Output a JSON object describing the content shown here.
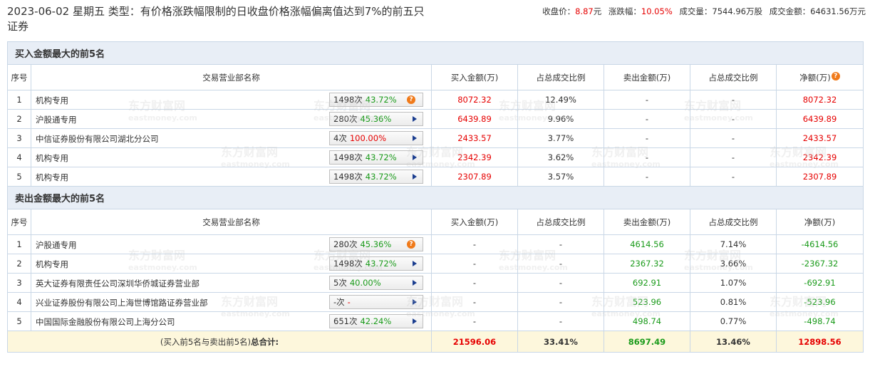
{
  "header": {
    "title": "2023-06-02 星期五 类型：有价格涨跌幅限制的日收盘价格涨幅偏离值达到7%的前五只证券",
    "close_label": "收盘价：",
    "close_value": "8.87",
    "close_unit": "元",
    "change_label": "涨跌幅：",
    "change_value": "10.05%",
    "volume_label": "成交量：",
    "volume_value": "7544.96万股",
    "amount_label": "成交金额：",
    "amount_value": "64631.56万元"
  },
  "buy_section": {
    "title": "买入金额最大的前5名",
    "columns": [
      "序号",
      "交易营业部名称",
      "买入金额(万)",
      "占总成交比例",
      "卖出金额(万)",
      "占总成交比例",
      "净额(万)"
    ],
    "rows": [
      {
        "idx": "1",
        "name": "机构专用",
        "times": "1498次",
        "pct": "43.72%",
        "icon": "question-icon",
        "buy": "8072.32",
        "buy_ratio": "12.49%",
        "sell": "-",
        "sell_ratio": "-",
        "net": "8072.32"
      },
      {
        "idx": "2",
        "name": "沪股通专用",
        "times": "280次",
        "pct": "45.36%",
        "icon": "arrow-right-icon",
        "buy": "6439.89",
        "buy_ratio": "9.96%",
        "sell": "-",
        "sell_ratio": "-",
        "net": "6439.89"
      },
      {
        "idx": "3",
        "name": "中信证券股份有限公司湖北分公司",
        "times": "4次",
        "pct": "100.00%",
        "icon": "arrow-right-icon",
        "buy": "2433.57",
        "buy_ratio": "3.77%",
        "sell": "-",
        "sell_ratio": "-",
        "net": "2433.57"
      },
      {
        "idx": "4",
        "name": "机构专用",
        "times": "1498次",
        "pct": "43.72%",
        "icon": "arrow-right-icon",
        "buy": "2342.39",
        "buy_ratio": "3.62%",
        "sell": "-",
        "sell_ratio": "-",
        "net": "2342.39"
      },
      {
        "idx": "5",
        "name": "机构专用",
        "times": "1498次",
        "pct": "43.72%",
        "icon": "arrow-right-icon",
        "buy": "2307.89",
        "buy_ratio": "3.57%",
        "sell": "-",
        "sell_ratio": "-",
        "net": "2307.89"
      }
    ]
  },
  "sell_section": {
    "title": "卖出金额最大的前5名",
    "columns": [
      "序号",
      "交易营业部名称",
      "买入金额(万)",
      "占总成交比例",
      "卖出金额(万)",
      "占总成交比例",
      "净额(万)"
    ],
    "rows": [
      {
        "idx": "1",
        "name": "沪股通专用",
        "times": "280次",
        "pct": "45.36%",
        "icon": "question-icon",
        "buy": "-",
        "buy_ratio": "-",
        "sell": "4614.56",
        "sell_ratio": "7.14%",
        "net": "-4614.56"
      },
      {
        "idx": "2",
        "name": "机构专用",
        "times": "1498次",
        "pct": "43.72%",
        "icon": "arrow-right-icon",
        "buy": "-",
        "buy_ratio": "-",
        "sell": "2367.32",
        "sell_ratio": "3.66%",
        "net": "-2367.32"
      },
      {
        "idx": "3",
        "name": "英大证券有限责任公司深圳华侨城证券营业部",
        "times": "5次",
        "pct": "40.00%",
        "icon": "arrow-right-icon",
        "buy": "-",
        "buy_ratio": "-",
        "sell": "692.91",
        "sell_ratio": "1.07%",
        "net": "-692.91"
      },
      {
        "idx": "4",
        "name": "兴业证券股份有限公司上海世博馆路证券营业部",
        "times": "-次",
        "pct": "-",
        "icon": "arrow-right-icon",
        "buy": "-",
        "buy_ratio": "-",
        "sell": "523.96",
        "sell_ratio": "0.81%",
        "net": "-523.96"
      },
      {
        "idx": "5",
        "name": "中国国际金融股份有限公司上海分公司",
        "times": "651次",
        "pct": "42.24%",
        "icon": "arrow-right-icon",
        "buy": "-",
        "buy_ratio": "-",
        "sell": "498.74",
        "sell_ratio": "0.77%",
        "net": "-498.74"
      }
    ]
  },
  "total": {
    "label_prefix": "(买入前5名与卖出前5名)",
    "label_bold": "总合计:",
    "buy": "21596.06",
    "buy_ratio": "33.41%",
    "sell": "8697.49",
    "sell_ratio": "13.46%",
    "net": "12898.56"
  },
  "watermark": {
    "cn": "东方财富网",
    "en": "eastmoney.com"
  },
  "colors": {
    "up": "#e60000",
    "down": "#1b9b1b",
    "section_bg": "#e8eef6",
    "total_bg": "#fdf7dc",
    "border": "#c9d7e6"
  }
}
